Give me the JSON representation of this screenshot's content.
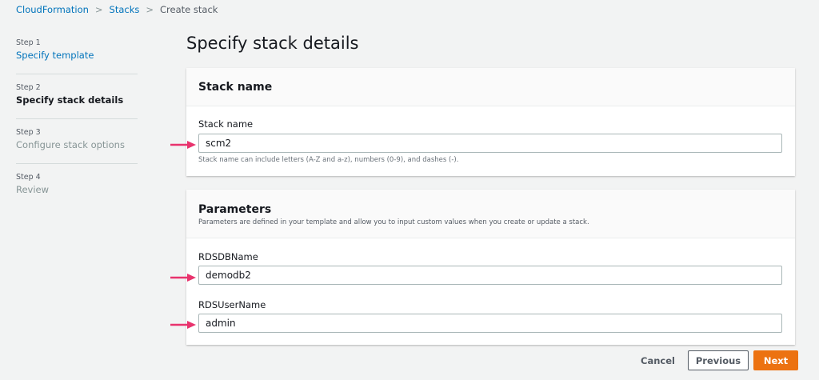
{
  "breadcrumb": [
    "CloudFormation",
    "Stacks",
    "Create stack"
  ],
  "steps": [
    {
      "step": "Step 1",
      "label": "Specify template"
    },
    {
      "step": "Step 2",
      "label": "Specify stack details"
    },
    {
      "step": "Step 3",
      "label": "Configure stack options"
    },
    {
      "step": "Step 4",
      "label": "Review"
    }
  ],
  "page_title": "Specify stack details",
  "stack_card": {
    "title": "Stack name",
    "field_label": "Stack name",
    "value": "scm2",
    "hint": "Stack name can include letters (A-Z and a-z), numbers (0-9), and dashes (-)."
  },
  "params_card": {
    "title": "Parameters",
    "description": "Parameters are defined in your template and allow you to input custom values when you create or update a stack.",
    "fields": [
      {
        "label": "RDSDBName",
        "value": "demodb2"
      },
      {
        "label": "RDSUserName",
        "value": "admin"
      }
    ]
  },
  "buttons": {
    "cancel": "Cancel",
    "previous": "Previous",
    "next": "Next"
  },
  "colors": {
    "accent": "#ec7211",
    "link": "#0073bb",
    "arrow": "#e8336d"
  }
}
